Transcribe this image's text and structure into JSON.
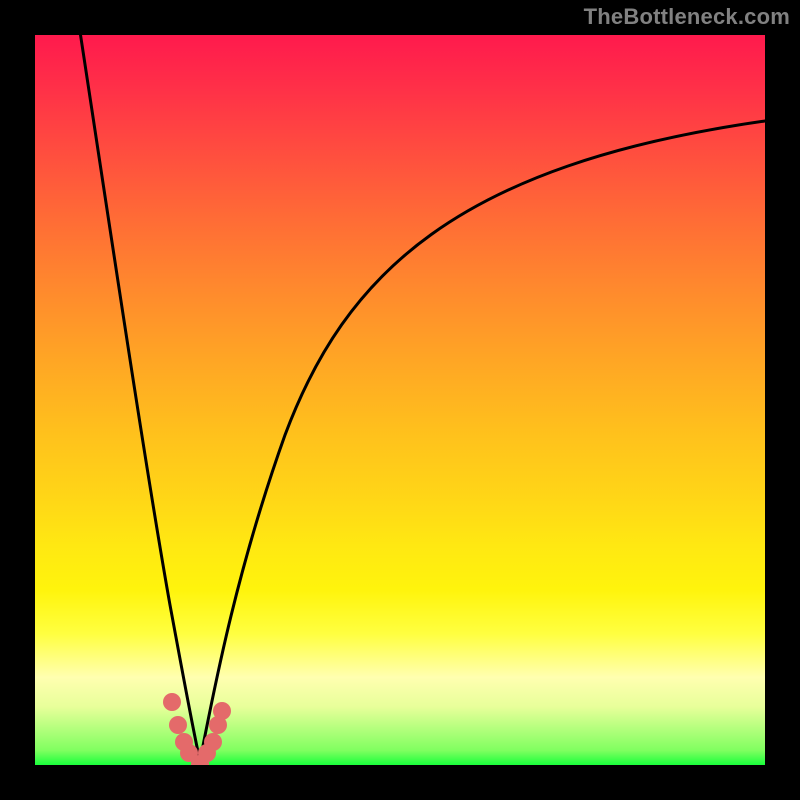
{
  "watermark": "TheBottleneck.com",
  "colors": {
    "background": "#000000",
    "curve": "#000000",
    "marker": "#e46a6a",
    "gradient_stops": [
      "#ff1a4d",
      "#ff2f48",
      "#ff4a40",
      "#ff6b36",
      "#ff8a2d",
      "#ffa724",
      "#ffc21c",
      "#ffd517",
      "#ffe812",
      "#fff40c",
      "#ffff40",
      "#ffffb0",
      "#e8ff9a",
      "#80ff60",
      "#19ff3b"
    ]
  },
  "chart_data": {
    "type": "line",
    "title": "",
    "xlabel": "",
    "ylabel": "",
    "xlim": [
      0,
      100
    ],
    "ylim": [
      0,
      100
    ],
    "grid": false,
    "legend": false,
    "series": [
      {
        "name": "left-branch",
        "x": [
          6,
          8,
          10,
          12,
          14,
          16,
          18,
          20,
          22
        ],
        "values": [
          100,
          80,
          62,
          46,
          32,
          20,
          11,
          4,
          0
        ]
      },
      {
        "name": "right-branch",
        "x": [
          22,
          26,
          30,
          36,
          44,
          54,
          66,
          80,
          100
        ],
        "values": [
          0,
          8,
          20,
          34,
          48,
          60,
          70,
          79,
          88
        ]
      }
    ],
    "markers": {
      "x": [
        18.7,
        19.6,
        20.4,
        21.0,
        22.0,
        23.0,
        24.0,
        24.8,
        25.4
      ],
      "y": [
        8.6,
        5.5,
        3.2,
        1.6,
        0.2,
        1.6,
        3.2,
        5.5,
        7.4
      ]
    },
    "minimum_x": 22
  }
}
